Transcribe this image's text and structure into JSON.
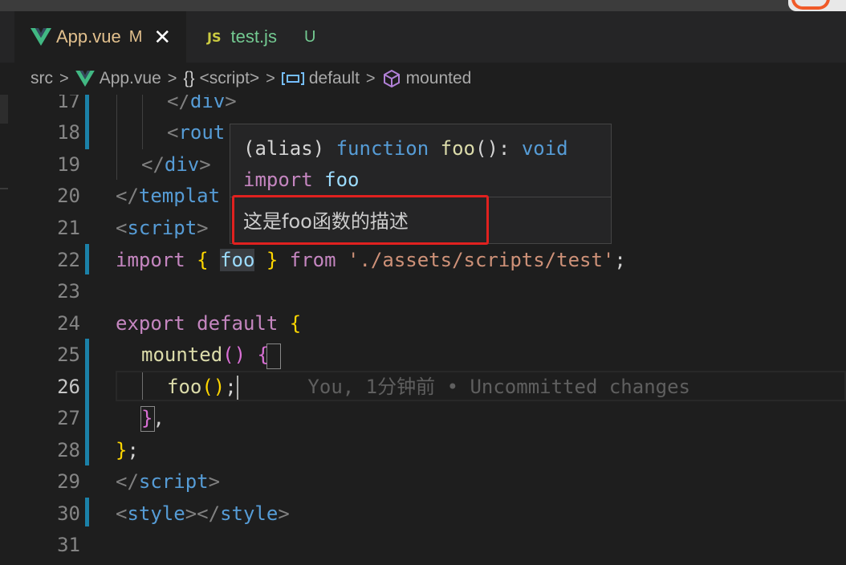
{
  "tabs": [
    {
      "label": "App.vue",
      "status": "M",
      "icon": "vue-icon",
      "active": true
    },
    {
      "label": "test.js",
      "status": "U",
      "icon": "js-icon",
      "badge": "JS",
      "active": false
    }
  ],
  "breadcrumb": {
    "src": "src",
    "file": "App.vue",
    "braces": "{}",
    "script": "<script>",
    "default": "default",
    "mounted": "mounted",
    "separator": ">"
  },
  "colors": {
    "accent_git": "#1b81a8",
    "tab_modified": "#e2c08d",
    "tab_untracked": "#73c991",
    "highlight_box": "#e0211f"
  },
  "editor": {
    "line_numbers": [
      "17",
      "18",
      "19",
      "20",
      "21",
      "22",
      "23",
      "24",
      "25",
      "26",
      "27",
      "28",
      "29",
      "30",
      "31"
    ],
    "current_line": "26",
    "lines": {
      "l17": {
        "open": "</",
        "tag": "div",
        "close": ">"
      },
      "l18": {
        "open": "<",
        "tag": "rout"
      },
      "l19": {
        "open": "</",
        "tag": "div",
        "close": ">"
      },
      "l20": {
        "open": "</",
        "tag": "templat"
      },
      "l21": {
        "open": "<",
        "tag": "script",
        "close": ">"
      },
      "l22": {
        "kw_import": "import",
        "lbrace": "{",
        "ident": "foo",
        "rbrace": "}",
        "kw_from": "from",
        "str": "'./assets/scripts/test'",
        "semi": ";"
      },
      "l24": {
        "kw_export": "export",
        "kw_default": "default",
        "lbrace": "{"
      },
      "l25": {
        "fn": "mounted",
        "parens": "()",
        "lbrace": "{"
      },
      "l26": {
        "fn": "foo",
        "parens": "()",
        "semi": ";",
        "blame": "You, 1分钟前 • Uncommitted changes"
      },
      "l27": {
        "rbrace": "}",
        "comma": ","
      },
      "l28": {
        "rbrace": "}",
        "semi": ";"
      },
      "l29": {
        "open": "</",
        "tag": "script",
        "close": ">"
      },
      "l30": {
        "open1": "<",
        "tag1": "style",
        "mid": "></",
        "tag2": "style",
        "close": ">"
      }
    }
  },
  "hover": {
    "alias": "(alias)",
    "function_kw": "function",
    "fn_name": "foo",
    "parens": "()",
    "colon": ":",
    "return_type": "void",
    "import_kw": "import",
    "import_name": "foo",
    "description": "这是foo函数的描述"
  }
}
